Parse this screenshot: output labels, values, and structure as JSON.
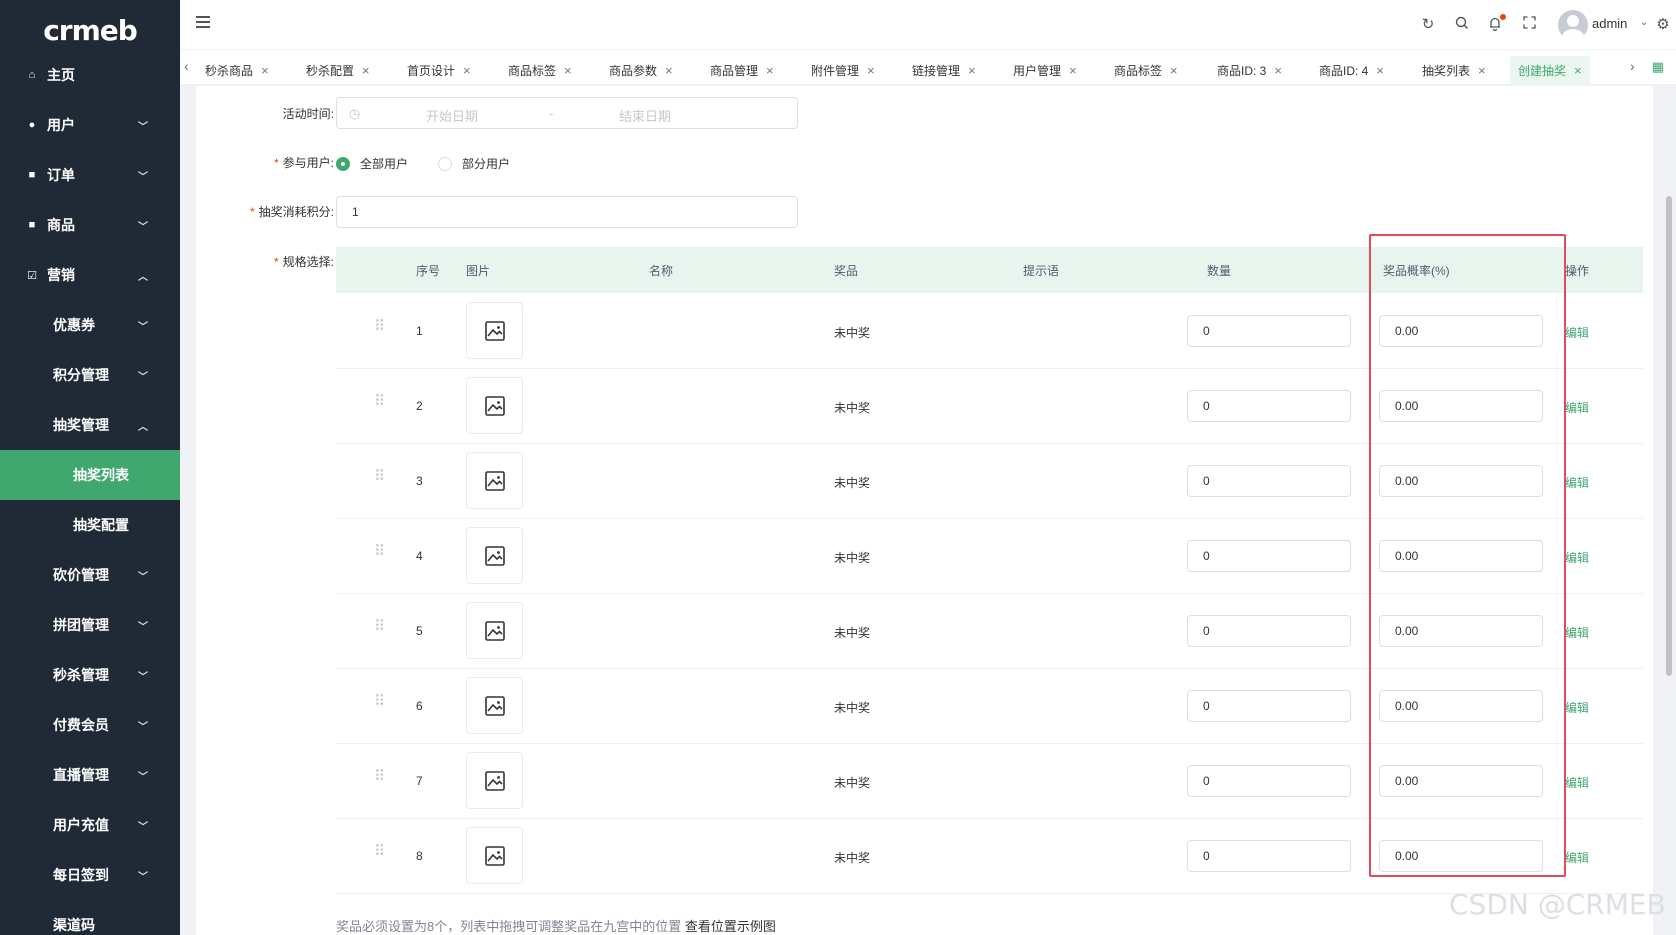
{
  "logo": {
    "text": "crmeb"
  },
  "sidebar": {
    "items": [
      {
        "label": "主页",
        "icon": "home-icon"
      },
      {
        "label": "用户",
        "icon": "user-icon",
        "expanded": false
      },
      {
        "label": "订单",
        "icon": "order-icon",
        "expanded": false
      },
      {
        "label": "商品",
        "icon": "product-icon",
        "expanded": false
      },
      {
        "label": "营销",
        "icon": "marketing-icon",
        "expanded": true
      },
      {
        "label": "优惠券",
        "expanded": false
      },
      {
        "label": "积分管理",
        "expanded": false
      },
      {
        "label": "抽奖管理",
        "expanded": true
      },
      {
        "label": "抽奖列表",
        "active": true
      },
      {
        "label": "抽奖配置"
      },
      {
        "label": "砍价管理",
        "expanded": false
      },
      {
        "label": "拼团管理",
        "expanded": false
      },
      {
        "label": "秒杀管理",
        "expanded": false
      },
      {
        "label": "付费会员",
        "expanded": false
      },
      {
        "label": "直播管理",
        "expanded": false
      },
      {
        "label": "用户充值",
        "expanded": false
      },
      {
        "label": "每日签到",
        "expanded": false
      },
      {
        "label": "渠道码"
      }
    ]
  },
  "header": {
    "user_name": "admin",
    "icons": [
      "menu-toggle-icon",
      "refresh-icon",
      "search-icon",
      "bell-icon",
      "fullscreen-icon",
      "settings-icon"
    ],
    "notification_dot_color": "#ed4014"
  },
  "tabs": [
    {
      "label": "秒杀商品"
    },
    {
      "label": "秒杀配置"
    },
    {
      "label": "首页设计"
    },
    {
      "label": "商品标签"
    },
    {
      "label": "商品参数"
    },
    {
      "label": "商品管理"
    },
    {
      "label": "附件管理"
    },
    {
      "label": "链接管理"
    },
    {
      "label": "用户管理"
    },
    {
      "label": "商品标签"
    },
    {
      "label": "商品ID: 3"
    },
    {
      "label": "商品ID: 4"
    },
    {
      "label": "抽奖列表"
    },
    {
      "label": "创建抽奖",
      "active": true
    }
  ],
  "form": {
    "activity_time": {
      "label": "活动时间:",
      "start_placeholder": "开始日期",
      "separator": "-",
      "end_placeholder": "结束日期"
    },
    "participants": {
      "label": "参与用户:",
      "options": [
        "全部用户",
        "部分用户"
      ],
      "selected": "全部用户"
    },
    "points_cost": {
      "label": "抽奖消耗积分:",
      "value": "1"
    },
    "spec": {
      "label": "规格选择:"
    }
  },
  "table": {
    "columns": [
      "序号",
      "图片",
      "名称",
      "奖品",
      "提示语",
      "数量",
      "奖品概率(%)",
      "操作"
    ],
    "rows": [
      {
        "seq": "1",
        "name": "",
        "prize": "未中奖",
        "tip": "",
        "quantity": "0",
        "probability": "0.00",
        "action": "编辑"
      },
      {
        "seq": "2",
        "name": "",
        "prize": "未中奖",
        "tip": "",
        "quantity": "0",
        "probability": "0.00",
        "action": "编辑"
      },
      {
        "seq": "3",
        "name": "",
        "prize": "未中奖",
        "tip": "",
        "quantity": "0",
        "probability": "0.00",
        "action": "编辑"
      },
      {
        "seq": "4",
        "name": "",
        "prize": "未中奖",
        "tip": "",
        "quantity": "0",
        "probability": "0.00",
        "action": "编辑"
      },
      {
        "seq": "5",
        "name": "",
        "prize": "未中奖",
        "tip": "",
        "quantity": "0",
        "probability": "0.00",
        "action": "编辑"
      },
      {
        "seq": "6",
        "name": "",
        "prize": "未中奖",
        "tip": "",
        "quantity": "0",
        "probability": "0.00",
        "action": "编辑"
      },
      {
        "seq": "7",
        "name": "",
        "prize": "未中奖",
        "tip": "",
        "quantity": "0",
        "probability": "0.00",
        "action": "编辑"
      },
      {
        "seq": "8",
        "name": "",
        "prize": "未中奖",
        "tip": "",
        "quantity": "0",
        "probability": "0.00",
        "action": "编辑"
      }
    ]
  },
  "hint": {
    "text": "奖品必须设置为8个，列表中拖拽可调整奖品在九宫中的位置",
    "link": "查看位置示例图"
  },
  "watermark": "CSDN @CRMEB",
  "colors": {
    "sidebar_bg": "#1f2a36",
    "accent": "#3fa86e",
    "highlight_box": "#e54a5c"
  }
}
